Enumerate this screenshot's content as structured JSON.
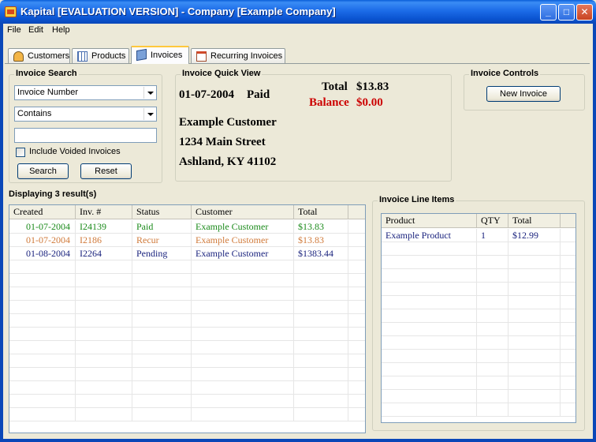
{
  "window": {
    "title": "Kapital [EVALUATION VERSION] - Company [Example Company]",
    "minimize_glyph": "_",
    "maximize_glyph": "□",
    "close_glyph": "✕"
  },
  "menu": [
    "File",
    "Edit",
    "Help"
  ],
  "tabs": [
    {
      "label": "Customers",
      "icon": "user-icon"
    },
    {
      "label": "Products",
      "icon": "grid-icon"
    },
    {
      "label": "Invoices",
      "icon": "box-icon",
      "active": true
    },
    {
      "label": "Recurring Invoices",
      "icon": "calendar-icon"
    }
  ],
  "search": {
    "title": "Invoice Search",
    "field_select": "Invoice Number",
    "operator_select": "Contains",
    "query_value": "",
    "include_voided_label": "Include Voided Invoices",
    "include_voided_checked": false,
    "search_label": "Search",
    "reset_label": "Reset"
  },
  "quick_view": {
    "title": "Invoice Quick View",
    "date": "01-07-2004",
    "status": "Paid",
    "total_label": "Total",
    "total_value": "$13.83",
    "balance_label": "Balance",
    "balance_value": "$0.00",
    "customer_name": "Example Customer",
    "address_line1": "1234 Main Street",
    "address_line2": "Ashland, KY 41102"
  },
  "controls": {
    "title": "Invoice Controls",
    "new_invoice_label": "New Invoice"
  },
  "results": {
    "count_label": "Displaying 3 result(s)",
    "columns": [
      "Created",
      "Inv. #",
      "Status",
      "Customer",
      "Total"
    ],
    "rows": [
      {
        "created": "01-07-2004",
        "number": "I24139",
        "status": "Paid",
        "customer": "Example Customer",
        "total": "$13.83",
        "color": "#1a8a1a"
      },
      {
        "created": "01-07-2004",
        "number": "I2186",
        "status": "Recur",
        "customer": "Example Customer",
        "total": "$13.83",
        "color": "#d07a3a"
      },
      {
        "created": "01-08-2004",
        "number": "I2264",
        "status": "Pending",
        "customer": "Example Customer",
        "total": "$1383.44",
        "color": "#1a237e"
      }
    ]
  },
  "line_items": {
    "title": "Invoice Line Items",
    "columns": [
      "Product",
      "QTY",
      "Total"
    ],
    "rows": [
      {
        "product": "Example Product",
        "qty": "1",
        "total": "$12.99",
        "color": "#1a237e"
      }
    ]
  },
  "colors": {
    "balance": "#cc0000",
    "titlebar": "#0a53d0"
  }
}
